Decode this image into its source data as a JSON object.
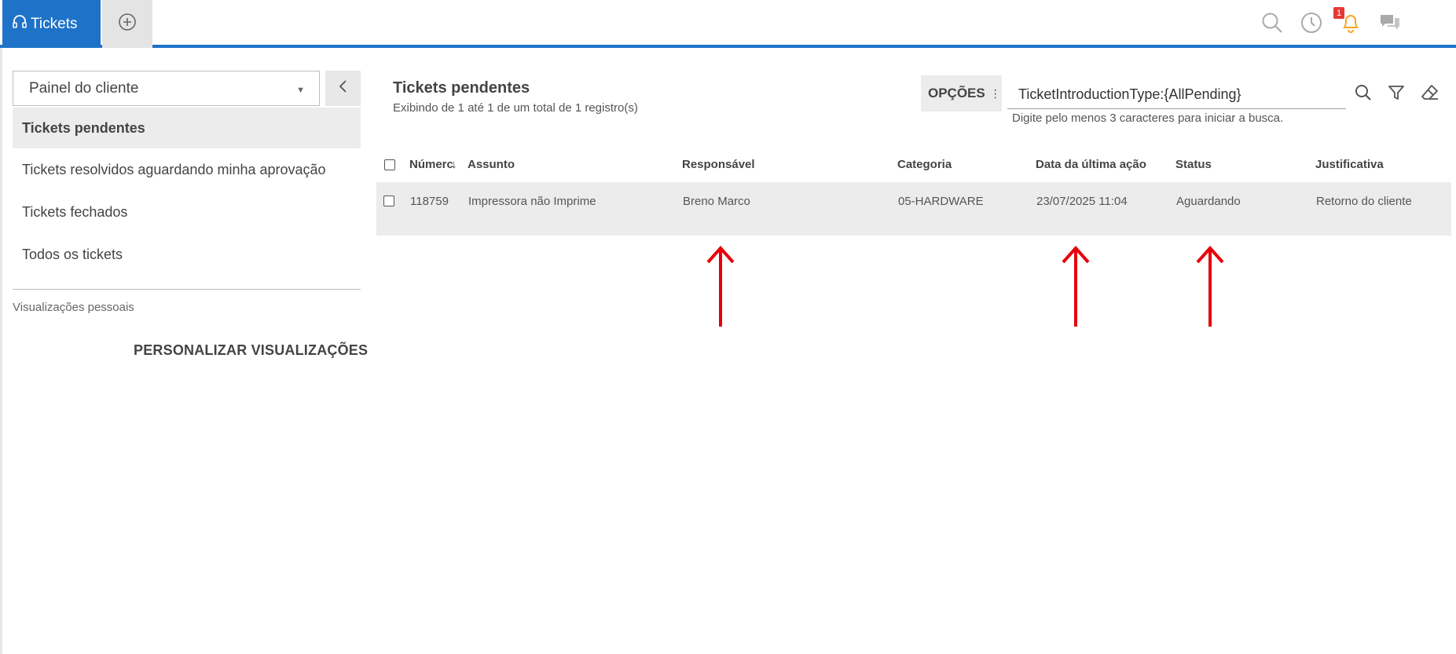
{
  "topbar": {
    "tab_active_label": "Tickets",
    "notification_count": "1",
    "accent_color": "#1e73c8",
    "icons": [
      "headset-icon",
      "add-tab-icon",
      "search-icon",
      "history-icon",
      "bell-icon",
      "chat-icon"
    ]
  },
  "sidebar": {
    "panel_select_value": "Painel do cliente",
    "items": [
      {
        "label": "Tickets pendentes",
        "active": true
      },
      {
        "label": "Tickets resolvidos aguardando minha aprovação",
        "active": false
      },
      {
        "label": "Tickets fechados",
        "active": false
      },
      {
        "label": "Todos os tickets",
        "active": false
      }
    ],
    "personal_views_label": "Visualizações pessoais",
    "personalize_button": "PERSONALIZAR VISUALIZAÇÕES"
  },
  "main": {
    "title": "Tickets pendentes",
    "subtitle": "Exibindo de 1 até 1 de um total de 1 registro(s)",
    "options_label": "OPÇÕES",
    "search_value": "TicketIntroductionType:{AllPending}",
    "search_hint": "Digite pelo menos 3 caracteres para iniciar a busca."
  },
  "table": {
    "headers": [
      "Númerc",
      "Assunto",
      "Responsável",
      "Categoria",
      "Data da última ação",
      "Status",
      "Justificativa"
    ],
    "rows": [
      {
        "numero": "118759",
        "assunto": "Impressora não Imprime",
        "responsavel": "Breno Marco",
        "categoria": "05-HARDWARE",
        "data": "23/07/2025 11:04",
        "status": "Aguardando",
        "justificativa": "Retorno do cliente"
      }
    ]
  },
  "annotation_color": "#e8000b"
}
